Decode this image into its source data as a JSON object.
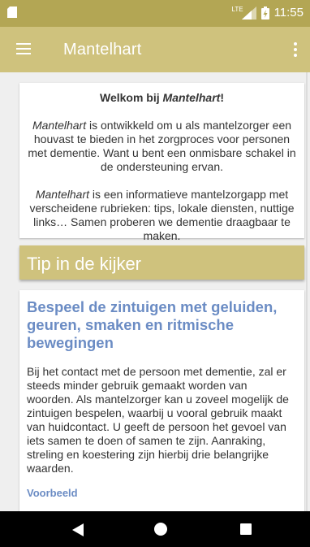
{
  "status_bar": {
    "network": "LTE",
    "time": "11:55",
    "icons": [
      "sd-card-icon",
      "signal-icon",
      "battery-charging-icon"
    ]
  },
  "app_bar": {
    "title": "Mantelhart",
    "icons": [
      "menu-icon",
      "more-vert-icon"
    ]
  },
  "welcome": {
    "title_prefix": "Welkom bij ",
    "title_app": "Mantelhart",
    "title_suffix": "!",
    "p1_app": "Mantelhart",
    "p1_text": " is ontwikkeld om u als mantelzorger een houvast te bieden in het zorgproces voor personen met dementie. Want u bent een onmisbare schakel in de ondersteuning ervan.",
    "p2_app": "Mantelhart",
    "p2_text": " is een informatieve mantelzorgapp met verscheidene rubrieken: tips, lokale diensten, nuttige links… Samen proberen we dementie draagbaar te maken."
  },
  "tip": {
    "header": "Tip in de kijker",
    "title": "Bespeel de zintuigen met geluiden, geuren, smaken en ritmische bewegingen",
    "body": "Bij het contact met de persoon met dementie, zal er steeds minder gebruik gemaakt worden van woorden. Als mantelzorger kan u zoveel mogelijk de zintuigen bespelen, waarbij u vooral gebruik maakt van huidcontact. U geeft de persoon het gevoel van iets samen te doen of samen te zijn. Aanraking, streling en koestering zijn hierbij drie belangrijke waarden.",
    "link": "Voorbeeld"
  },
  "nav_bar": {
    "icons": [
      "back-icon",
      "home-icon",
      "recents-icon"
    ]
  },
  "colors": {
    "status_bar": "#b3a654",
    "app_bar": "#cfc27d",
    "accent_blue": "#6b8cc4",
    "background": "#efefef"
  }
}
